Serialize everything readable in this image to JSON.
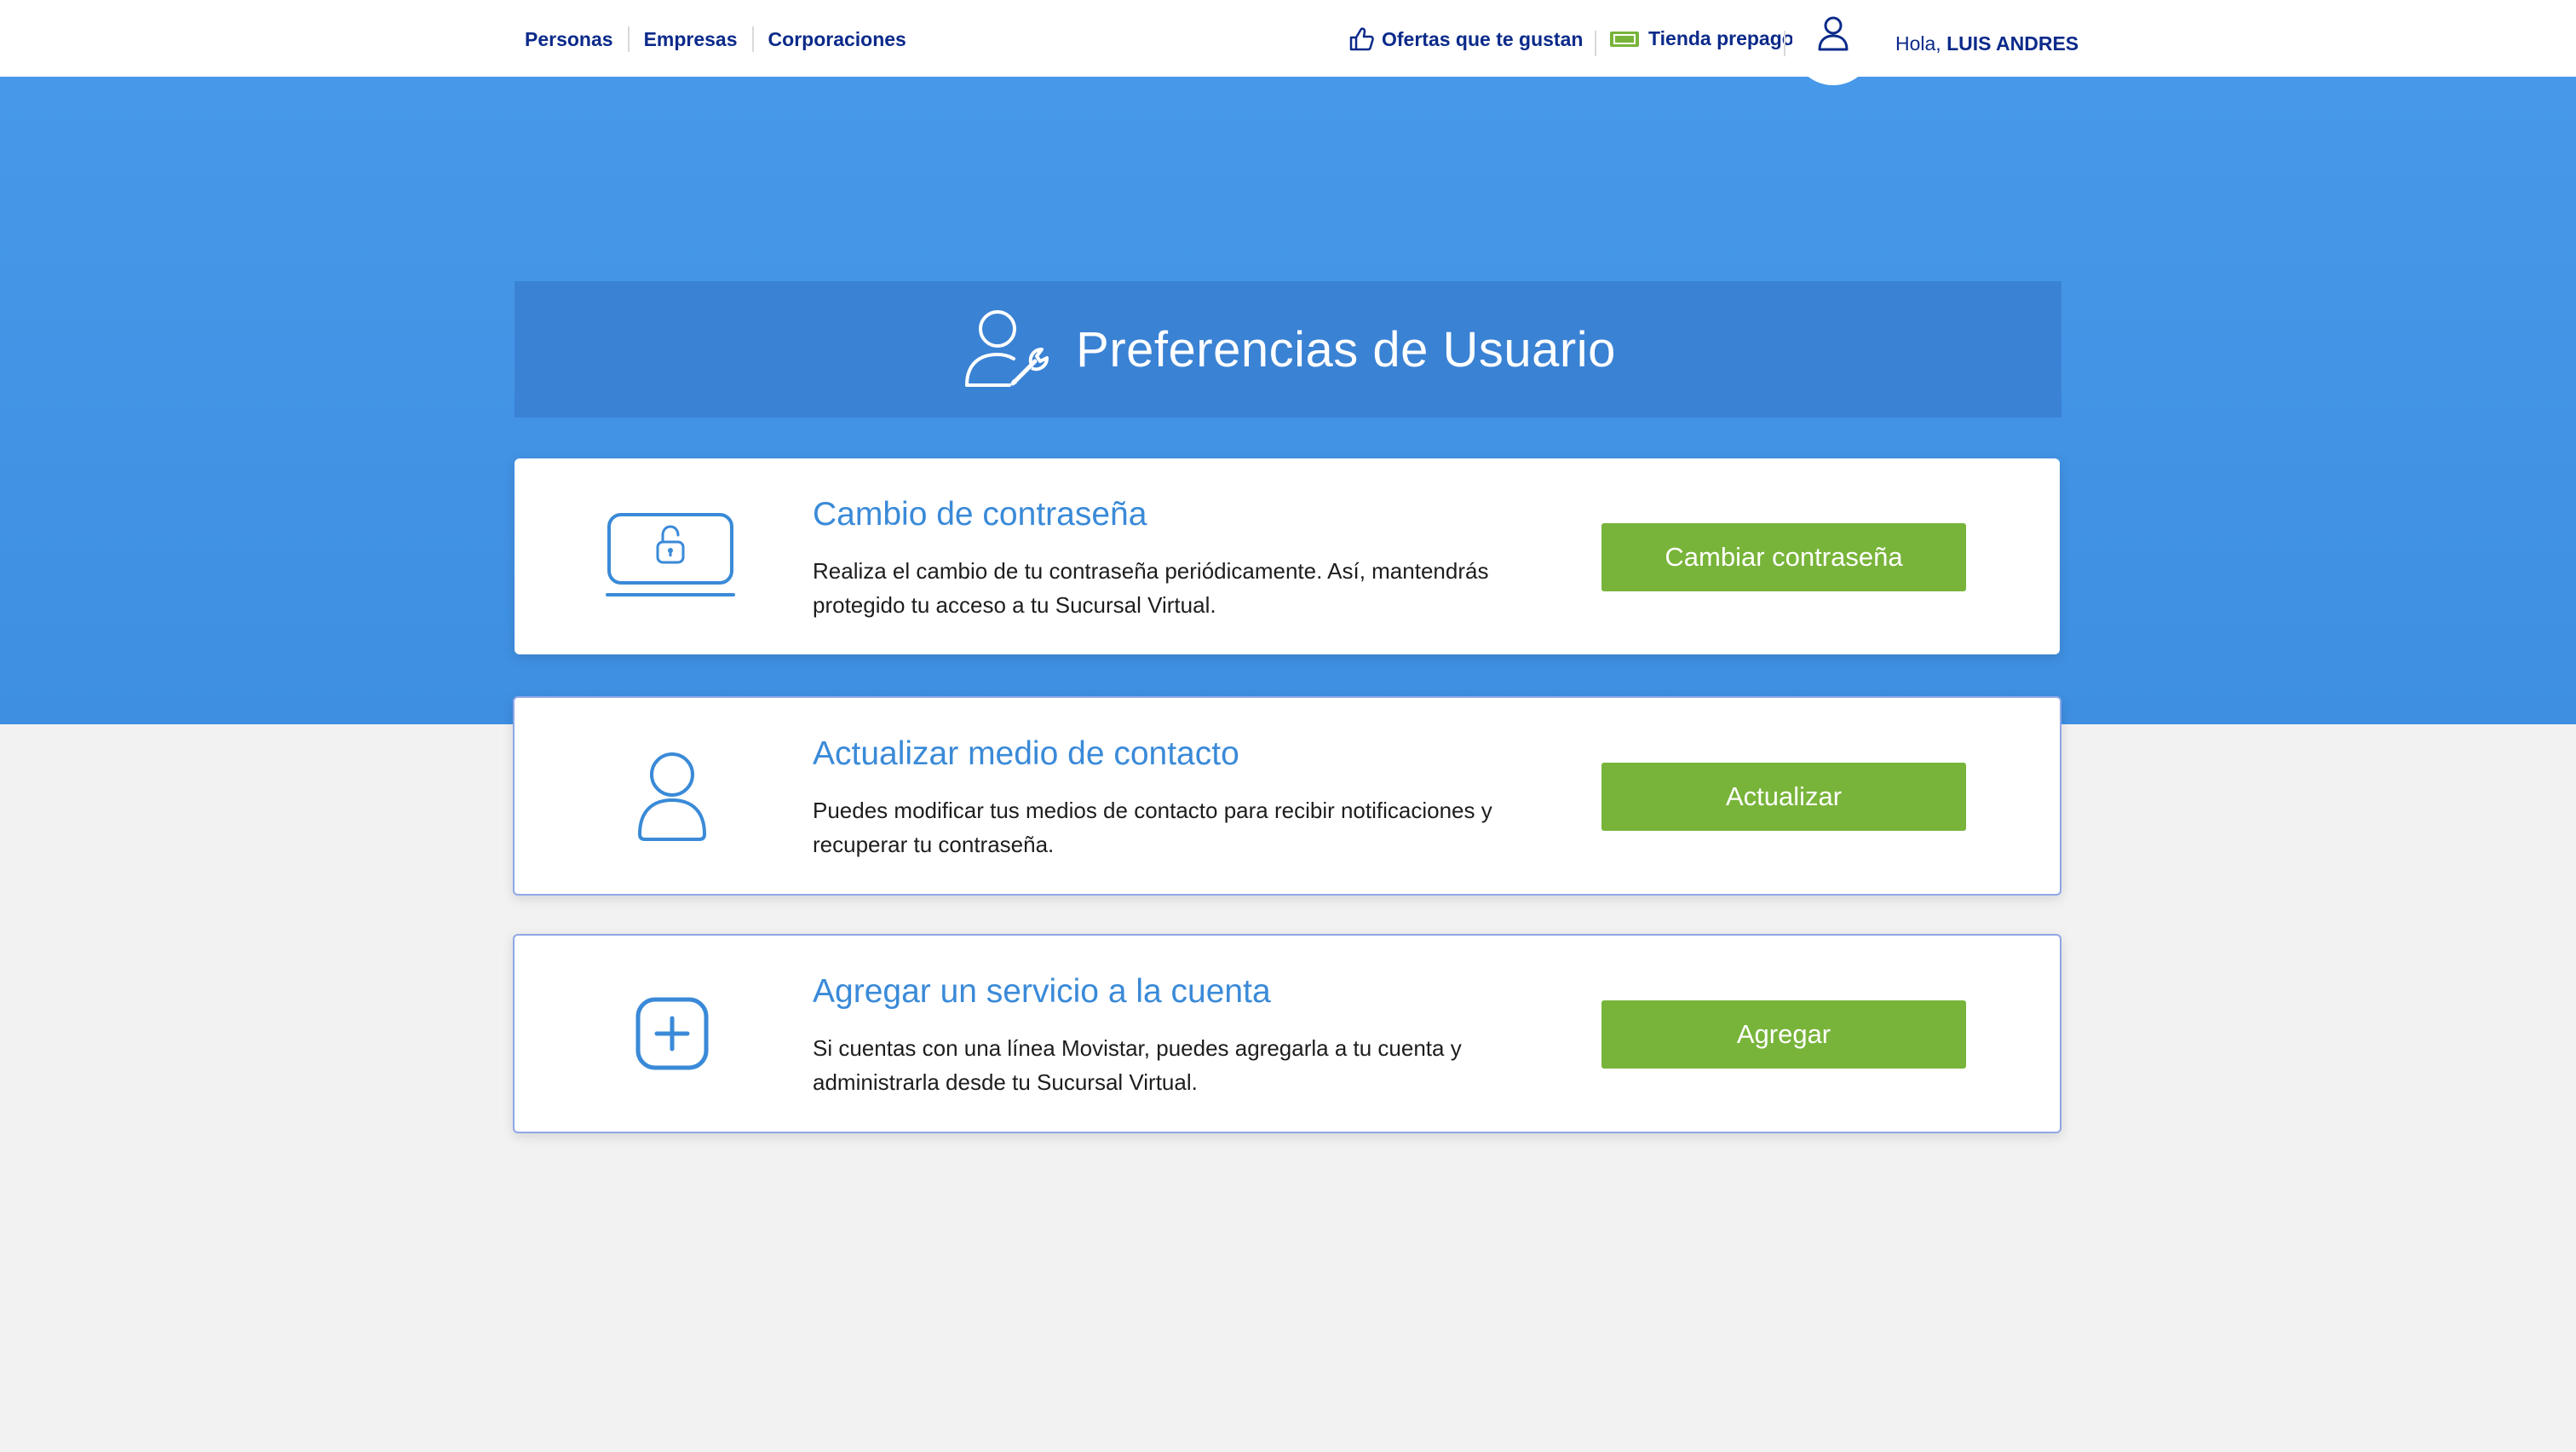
{
  "nav": {
    "links": [
      "Personas",
      "Empresas",
      "Corporaciones"
    ],
    "offers_label": "Ofertas que te gustan",
    "store_label": "Tienda prepago",
    "greeting_prefix": "Hola, ",
    "user_name": "LUIS ANDRES"
  },
  "header": {
    "title": "Preferencias de Usuario"
  },
  "cards": [
    {
      "icon": "laptop-lock-icon",
      "title": "Cambio de contraseña",
      "description": "Realiza el cambio de tu contraseña periódicamente. Así, mantendrás protegido tu acceso a tu Sucursal Virtual.",
      "button": "Cambiar contraseña"
    },
    {
      "icon": "user-icon",
      "title": "Actualizar medio de contacto",
      "description": "Puedes modificar tus medios de contacto para recibir notificaciones y recuperar tu contraseña.",
      "button": "Actualizar"
    },
    {
      "icon": "plus-square-icon",
      "title": "Agregar un servicio a la cuenta",
      "description": "Si cuentas con una línea Movistar, puedes agregarla a tu cuenta y administrarla desde tu Sucursal Virtual.",
      "button": "Agregar"
    }
  ],
  "colors": {
    "brand_navy": "#0b2a8a",
    "hero_blue": "#4798e8",
    "title_bar": "#3a82d4",
    "accent_blue": "#3a8ad8",
    "button_green": "#78b43a",
    "page_bg": "#f2f2f2"
  }
}
